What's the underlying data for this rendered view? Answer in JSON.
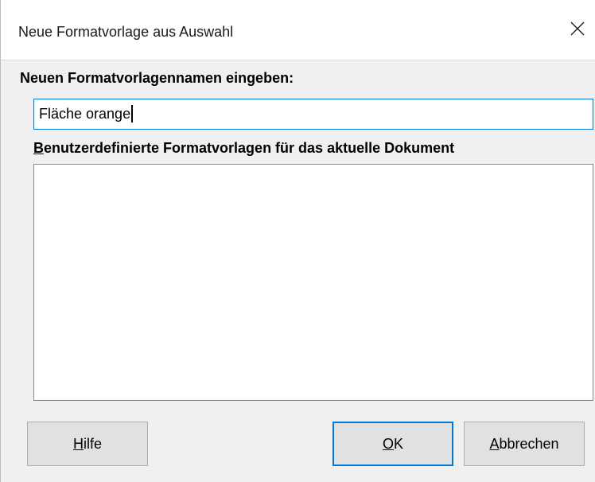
{
  "dialog": {
    "title": "Neue Formatvorlage aus Auswahl",
    "close_icon": "close-icon"
  },
  "form": {
    "name_label": "Neuen Formatvorlagennamen eingeben:",
    "name_value": "Fläche orange",
    "list_label_accel": "B",
    "list_label_rest": "enutzerdefinierte Formatvorlagen für das aktuelle Dokument",
    "custom_styles": []
  },
  "buttons": {
    "help_accel": "H",
    "help_rest": "ilfe",
    "ok_accel": "O",
    "ok_rest": "K",
    "cancel_accel": "A",
    "cancel_rest": "bbrechen"
  },
  "colors": {
    "focus_accent": "#0078d7",
    "dialog_background": "#f0f0f0",
    "button_background": "#e1e1e1"
  }
}
